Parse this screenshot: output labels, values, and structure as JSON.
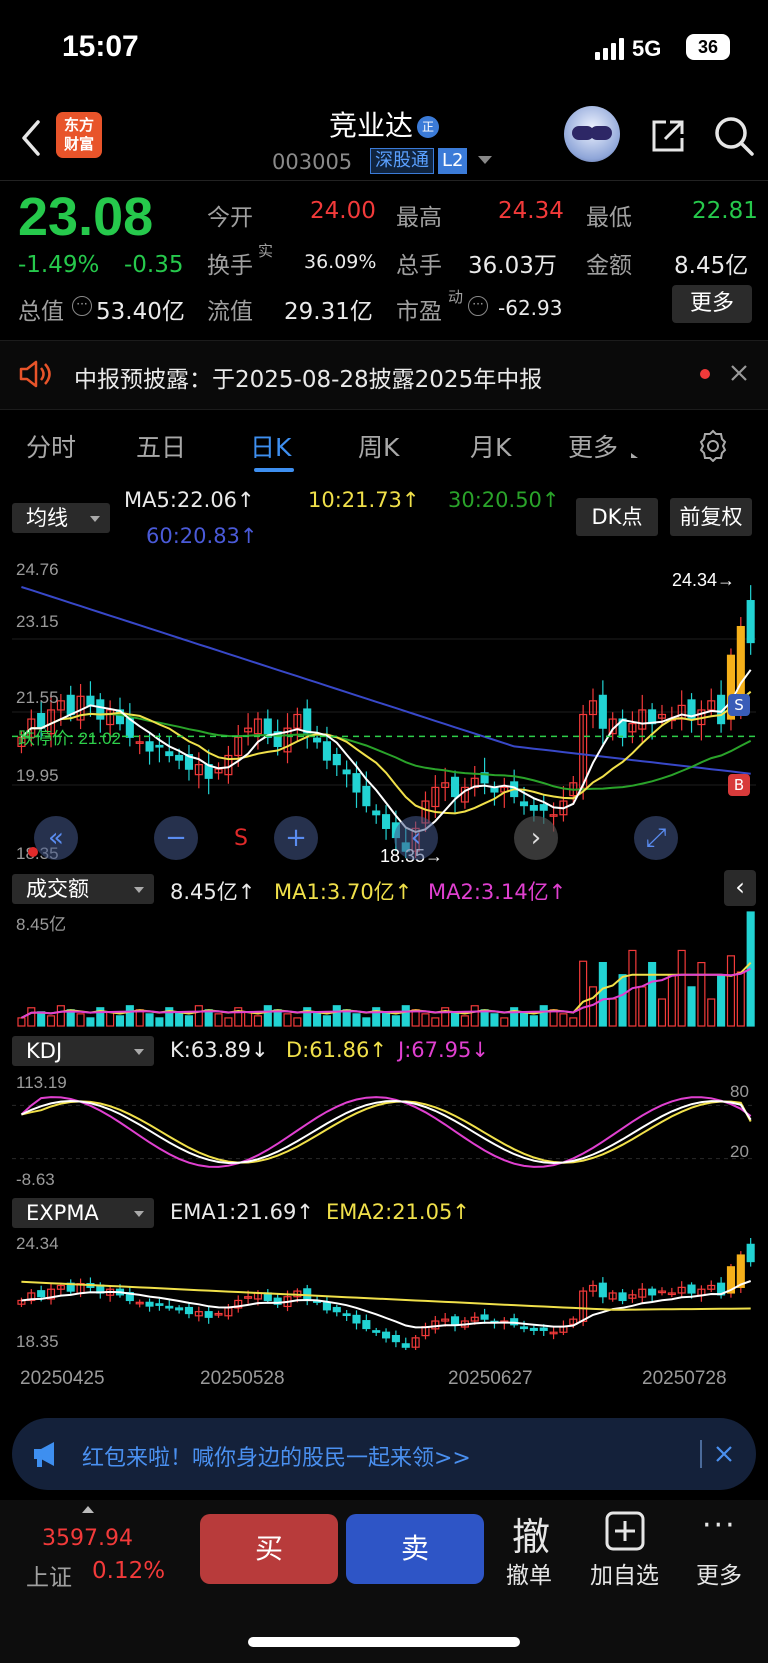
{
  "status_bar": {
    "time": "15:07",
    "network": "5G",
    "battery": "36"
  },
  "header": {
    "logo_line1": "东方",
    "logo_line2": "财富",
    "stock_name": "竞业达",
    "badge": "正",
    "stock_code": "003005",
    "tag_connect": "深股通",
    "tag_level": "L2"
  },
  "quote": {
    "price": "23.08",
    "change_pct": "-1.49%",
    "change": "-0.35",
    "open_label": "今开",
    "open": "24.00",
    "high_label": "最高",
    "high": "24.34",
    "low_label": "最低",
    "low": "22.81",
    "turnover_label": "换手",
    "turnover_sup": "实",
    "turnover": "36.09%",
    "volume_label": "总手",
    "volume": "36.03万",
    "amount_label": "金额",
    "amount": "8.45亿",
    "mktcap_label": "总值",
    "mktcap": "53.40亿",
    "float_label": "流值",
    "float": "29.31亿",
    "pe_label": "市盈",
    "pe_sup": "动",
    "pe": "-62.93",
    "more_button": "更多"
  },
  "notice": {
    "text": "中报预披露：于2025-08-28披露2025年中报"
  },
  "tabs": [
    {
      "label": "分时"
    },
    {
      "label": "五日"
    },
    {
      "label": "日K"
    },
    {
      "label": "周K"
    },
    {
      "label": "月K"
    },
    {
      "label": "更多"
    }
  ],
  "main_chart": {
    "indicator_select": "均线",
    "ma5": "MA5:22.06↑",
    "ma10": "10:21.73↑",
    "ma30": "30:20.50↑",
    "ma60": "60:20.83↑",
    "dk_button": "DK点",
    "adjust_button": "前复权",
    "axis_top": "24.76",
    "axis_2": "23.15",
    "axis_3": "21.55",
    "axis_4": "19.95",
    "axis_bottom": "18.35",
    "limit_down_label": "跌停价: 21.02",
    "high_marker": "24.34→",
    "low_marker": "18.35→",
    "marker_s": "S",
    "marker_b": "B",
    "nav_s": "S"
  },
  "volume_chart": {
    "indicator_select": "成交额",
    "value": "8.45亿↑",
    "ma1": "MA1:3.70亿↑",
    "ma2": "MA2:3.14亿↑",
    "axis_top": "8.45亿"
  },
  "kdj_chart": {
    "indicator_select": "KDJ",
    "k": "K:63.89↓",
    "d": "D:61.86↑",
    "j": "J:67.95↓",
    "axis_top": "113.19",
    "axis_bottom": "-8.63",
    "level_80": "80",
    "level_20": "20"
  },
  "expma_chart": {
    "indicator_select": "EXPMA",
    "ema1": "EMA1:21.69↑",
    "ema2": "EMA2:21.05↑",
    "axis_top": "24.34",
    "axis_bottom": "18.35"
  },
  "dates": [
    "20250425",
    "20250528",
    "20250627",
    "20250728"
  ],
  "banner": {
    "text": "红包来啦！喊你身边的股民一起来领>>"
  },
  "bottom_bar": {
    "index_value": "3597.94",
    "index_name": "上证",
    "index_change": "0.12%",
    "buy": "买",
    "sell": "卖",
    "cancel_icon": "撤",
    "cancel": "撤单",
    "add_watch": "加自选",
    "more": "更多"
  },
  "colors": {
    "up": "#f23a3a",
    "down": "#22d3d3",
    "price_down": "#26c94c",
    "accent": "#3e8ff0",
    "ma5": "#ffffff",
    "ma10": "#f0e04a",
    "ma30": "#2aa32a",
    "ma60": "#3848c8"
  },
  "chart_data": {
    "type": "candlestick",
    "title": "日K",
    "x_labels": [
      "20250425",
      "20250528",
      "20250627",
      "20250728"
    ],
    "ylim": [
      18.35,
      24.76
    ],
    "series": [
      {
        "name": "MA5",
        "last": 22.06
      },
      {
        "name": "10",
        "last": 21.73
      },
      {
        "name": "30",
        "last": 20.5
      },
      {
        "name": "60",
        "last": 20.83
      }
    ],
    "close": [
      21.0,
      21.4,
      21.2,
      21.6,
      21.8,
      21.5,
      21.9,
      21.7,
      21.4,
      21.6,
      21.3,
      21.0,
      20.9,
      20.7,
      20.8,
      20.6,
      20.5,
      20.3,
      20.4,
      20.1,
      20.3,
      20.6,
      21.0,
      21.2,
      21.4,
      21.0,
      20.8,
      21.2,
      21.5,
      21.1,
      20.9,
      20.5,
      20.4,
      20.2,
      19.8,
      19.5,
      19.3,
      19.0,
      18.8,
      18.5,
      19.0,
      19.6,
      19.9,
      20.0,
      19.7,
      19.9,
      20.1,
      20.0,
      19.8,
      19.9,
      19.7,
      19.5,
      19.4,
      19.4,
      19.3,
      19.6,
      20.0,
      21.5,
      21.8,
      21.2,
      21.4,
      21.0,
      21.3,
      21.6,
      21.3,
      21.5,
      21.4,
      21.7,
      21.4,
      21.6,
      21.8,
      21.3,
      22.8,
      23.43,
      23.08
    ]
  }
}
